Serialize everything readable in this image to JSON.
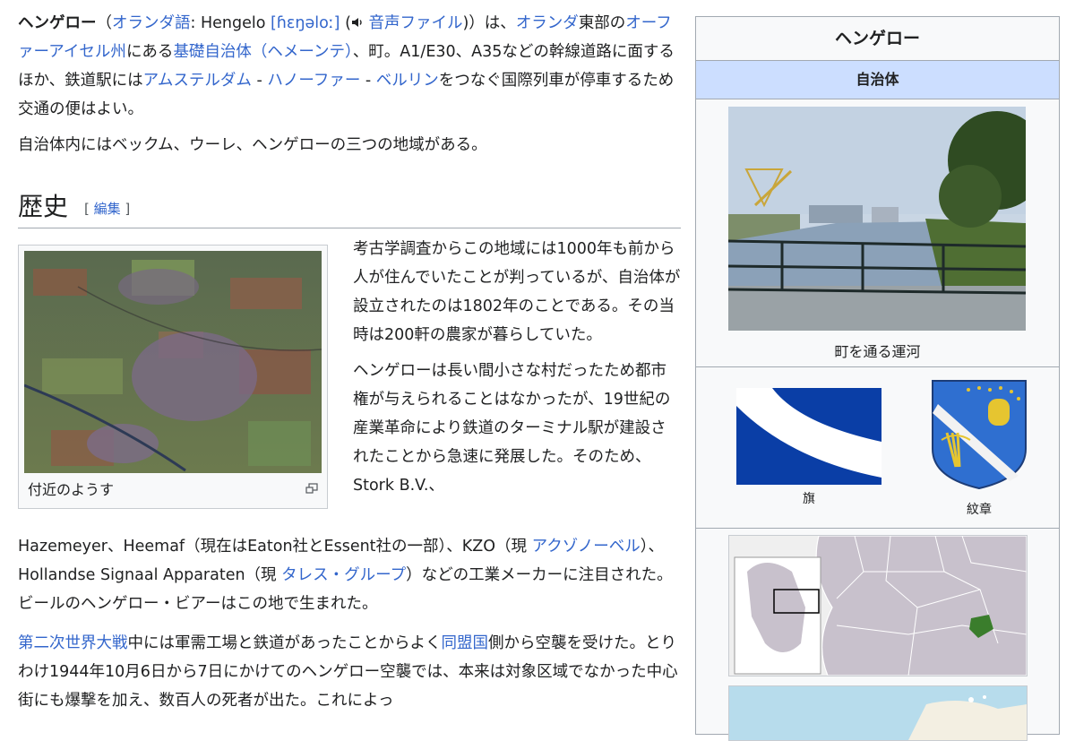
{
  "article": {
    "lead": {
      "name": "ヘンゲロー",
      "paren_open": "（",
      "lang_link": "オランダ語",
      "lang_sep": ": Hengelo ",
      "ipa": "[ɦɛŋəloː]",
      "audio_paren_open": " (",
      "audio_link": "音声ファイル",
      "paren_close": ")）は、",
      "country_link": "オランダ",
      "t1": "東部の",
      "province_link": "オーファーアイセル州",
      "t2": "にある",
      "municipality_link": "基礎自治体（ヘメーンテ）",
      "t3": "、町。A1/E30、A35などの幹線道路に面するほか、鉄道駅には",
      "city1_link": "アムステルダム",
      "sep1": " - ",
      "city2_link": "ハノーファー",
      "sep2": " - ",
      "city3_link": "ベルリン",
      "t4": "をつなぐ国際列車が停車するため交通の便はよい。"
    },
    "para2": "自治体内にはベックム、ウーレ、ヘンゲローの三つの地域がある。",
    "history": {
      "heading": "歴史",
      "edit_open": "[ ",
      "edit_link": "編集",
      "edit_close": " ]",
      "thumb_caption": "付近のようす",
      "p1": "考古学調査からこの地域には1000年も前から人が住んでいたことが判っているが、自治体が設立されたのは1802年のことである。その当時は200軒の農家が暮らしていた。",
      "p2_a": "ヘンゲローは長い間小さな村だったため都市権が与えられることはなかったが、19世紀の産業革命により鉄道のターミナル駅が建設されたことから急速に発展した。そのため、Stork B.V.、",
      "p2_b1": "Hazemeyer、Heemaf（現在はEaton社とEssent社の一部）、KZO（現 ",
      "p2_link1": "アクゾノーベル",
      "p2_b2": "）、Hollandse Signaal Apparaten（現 ",
      "p2_link2": "タレス・グループ",
      "p2_b3": "）などの工業メーカーに注目された。ビールのヘンゲロー・ビアーはこの地で生まれた。",
      "p3_link1": "第二次世界大戦",
      "p3_a": "中には軍需工場と鉄道があったことからよく",
      "p3_link2": "同盟国",
      "p3_b": "側から空襲を受けた。とりわけ1944年10月6日から7日にかけてのヘンゲロー空襲では、本来は対象区域でなかった中心街にも爆撃を加え、数百人の死者が出た。これによっ"
    }
  },
  "infobox": {
    "title": "ヘンゲロー",
    "subtitle": "自治体",
    "photo_caption": "町を通る運河",
    "flag_caption": "旗",
    "coa_caption": "紋章"
  },
  "colors": {
    "link": "#3366cc",
    "infobox_header": "#ccdeff",
    "flag_blue": "#0a3ea6",
    "highlight_green": "#3a7d2c"
  }
}
